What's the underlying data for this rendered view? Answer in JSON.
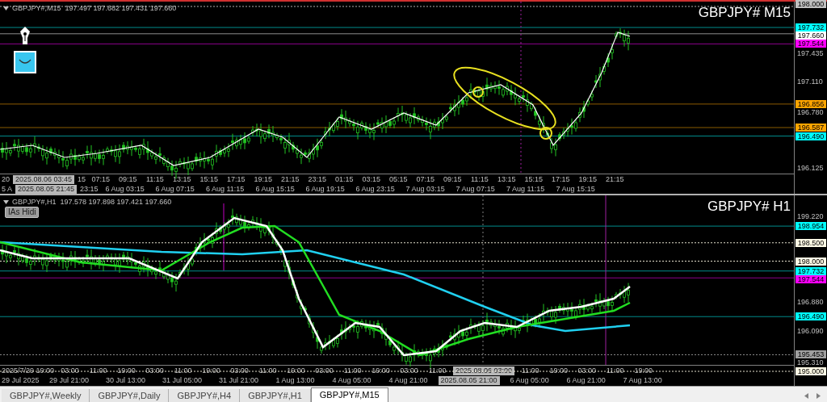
{
  "chart_panes": [
    {
      "header": "GBPJPY#,M15  197.497 197.682 197.431 197.660",
      "title": "GBPJPY# M15",
      "price_labels": [
        {
          "text": "198.000",
          "kind": "tag",
          "color": "#c0c0c0",
          "dotted": true
        },
        {
          "text": "197.732",
          "kind": "tag",
          "color": "#00ffff",
          "dotted": false
        },
        {
          "text": "197.660",
          "kind": "tag",
          "color": "#ffffff",
          "dotted": false
        },
        {
          "text": "197.544",
          "kind": "tag",
          "color": "#ff00ff",
          "dotted": false
        },
        {
          "text": "197.435",
          "kind": "plain"
        },
        {
          "text": "197.110",
          "kind": "plain"
        },
        {
          "text": "196.856",
          "kind": "tag",
          "color": "#ffa500",
          "dotted": false
        },
        {
          "text": "196.780",
          "kind": "plain"
        },
        {
          "text": "196.587",
          "kind": "tag",
          "color": "#ffa500",
          "dotted": false
        },
        {
          "text": "196.490",
          "kind": "tag",
          "color": "#00ffff",
          "dotted": false
        },
        {
          "text": "196.125",
          "kind": "plain"
        }
      ],
      "time_axis": [
        [
          {
            "kind": "partial",
            "text": "20"
          },
          {
            "kind": "tag",
            "text": "2025.08.06 03:45"
          },
          {
            "kind": "partial",
            "text": "15"
          },
          {
            "kind": "label",
            "text": "07:15"
          },
          {
            "kind": "label",
            "text": "09:15"
          },
          {
            "kind": "label",
            "text": "11:15"
          },
          {
            "kind": "label",
            "text": "13:15"
          },
          {
            "kind": "label",
            "text": "15:15"
          },
          {
            "kind": "label",
            "text": "17:15"
          },
          {
            "kind": "label",
            "text": "19:15"
          },
          {
            "kind": "label",
            "text": "21:15"
          },
          {
            "kind": "label",
            "text": "23:15"
          },
          {
            "kind": "label",
            "text": "01:15"
          },
          {
            "kind": "label",
            "text": "03:15"
          },
          {
            "kind": "label",
            "text": "05:15"
          },
          {
            "kind": "label",
            "text": "07:15"
          },
          {
            "kind": "label",
            "text": "09:15"
          },
          {
            "kind": "label",
            "text": "11:15"
          },
          {
            "kind": "label",
            "text": "13:15"
          },
          {
            "kind": "label",
            "text": "15:15"
          },
          {
            "kind": "label",
            "text": "17:15"
          },
          {
            "kind": "label",
            "text": "19:15"
          },
          {
            "kind": "label",
            "text": "21:15"
          }
        ],
        [
          {
            "kind": "partial",
            "text": "5 A"
          },
          {
            "kind": "tag",
            "text": "2025.08.05 21:45"
          },
          {
            "kind": "partial",
            "text": "23:15"
          },
          {
            "kind": "label",
            "text": "6 Aug 03:15"
          },
          {
            "kind": "label",
            "text": "6 Aug 07:15"
          },
          {
            "kind": "label",
            "text": "6 Aug 11:15"
          },
          {
            "kind": "label",
            "text": "6 Aug 15:15"
          },
          {
            "kind": "label",
            "text": "6 Aug 19:15"
          },
          {
            "kind": "label",
            "text": "6 Aug 23:15"
          },
          {
            "kind": "label",
            "text": "7 Aug 03:15"
          },
          {
            "kind": "label",
            "text": "7 Aug 07:15"
          },
          {
            "kind": "label",
            "text": "7 Aug 11:15"
          },
          {
            "kind": "label",
            "text": "7 Aug 15:15"
          }
        ]
      ]
    },
    {
      "header": "GBPJPY#,H1  197.578 197.898 197.421 197.660",
      "title": "GBPJPY# H1",
      "button": "IAs Hidi",
      "price_labels": [
        {
          "text": "199.220",
          "kind": "plain"
        },
        {
          "text": "198.954",
          "kind": "tag",
          "color": "#00ffff",
          "dotted": false
        },
        {
          "text": "198.500",
          "kind": "tag",
          "color": "#fffbe6",
          "dotted": true
        },
        {
          "text": "198.000",
          "kind": "tag",
          "color": "#fffbe6",
          "dotted": true
        },
        {
          "text": "197.732",
          "kind": "tag",
          "color": "#00ffff",
          "dotted": false
        },
        {
          "text": "197.544",
          "kind": "tag",
          "color": "#ff00ff",
          "dotted": false
        },
        {
          "text": "196.880",
          "kind": "plain"
        },
        {
          "text": "196.490",
          "kind": "tag",
          "color": "#00ffff",
          "dotted": false
        },
        {
          "text": "196.090",
          "kind": "plain"
        },
        {
          "text": "195.453",
          "kind": "tag",
          "color": "#a0a0a0",
          "dotted": true
        },
        {
          "text": "195.310",
          "kind": "plain"
        },
        {
          "text": "195.000",
          "kind": "tag",
          "color": "#fffbe6",
          "dotted": true
        }
      ],
      "time_axis": [
        [
          {
            "kind": "partial",
            "text": "2025/7/29 19:00"
          },
          {
            "kind": "label",
            "text": "03:00"
          },
          {
            "kind": "label",
            "text": "11:00"
          },
          {
            "kind": "label",
            "text": "19:00"
          },
          {
            "kind": "label",
            "text": "03:00"
          },
          {
            "kind": "label",
            "text": "11:00"
          },
          {
            "kind": "label",
            "text": "19:00"
          },
          {
            "kind": "label",
            "text": "03:00"
          },
          {
            "kind": "label",
            "text": "11:00"
          },
          {
            "kind": "label",
            "text": "19:00"
          },
          {
            "kind": "label",
            "text": "03:00"
          },
          {
            "kind": "label",
            "text": "11:00"
          },
          {
            "kind": "label",
            "text": "19:00"
          },
          {
            "kind": "label",
            "text": "03:00"
          },
          {
            "kind": "label",
            "text": "11:00"
          },
          {
            "kind": "tag",
            "text": "2025.08.06 03:00"
          },
          {
            "kind": "label",
            "text": "11:00"
          },
          {
            "kind": "label",
            "text": "19:00"
          },
          {
            "kind": "label",
            "text": "03:00"
          },
          {
            "kind": "label",
            "text": "11:00"
          },
          {
            "kind": "label",
            "text": "19:00"
          }
        ],
        [
          {
            "kind": "partial",
            "text": "29 Jul 2025"
          },
          {
            "kind": "label",
            "text": "29 Jul 21:00"
          },
          {
            "kind": "label",
            "text": "30 Jul 13:00"
          },
          {
            "kind": "label",
            "text": "31 Jul 05:00"
          },
          {
            "kind": "label",
            "text": "31 Jul 21:00"
          },
          {
            "kind": "label",
            "text": "1 Aug 13:00"
          },
          {
            "kind": "label",
            "text": "4 Aug 05:00"
          },
          {
            "kind": "label",
            "text": "4 Aug 21:00"
          },
          {
            "kind": "tag",
            "text": "2025.08.05 21:00"
          },
          {
            "kind": "label",
            "text": "6 Aug 05:00"
          },
          {
            "kind": "label",
            "text": "6 Aug 21:00"
          },
          {
            "kind": "label",
            "text": "7 Aug 13:00"
          }
        ]
      ]
    }
  ],
  "tabs": [
    {
      "label": "GBPJPY#,Weekly",
      "selected": false
    },
    {
      "label": "GBPJPY#,Daily",
      "selected": false
    },
    {
      "label": "GBPJPY#,H4",
      "selected": false
    },
    {
      "label": "GBPJPY#,H1",
      "selected": false
    },
    {
      "label": "GBPJPY#,M15",
      "selected": true
    }
  ]
}
